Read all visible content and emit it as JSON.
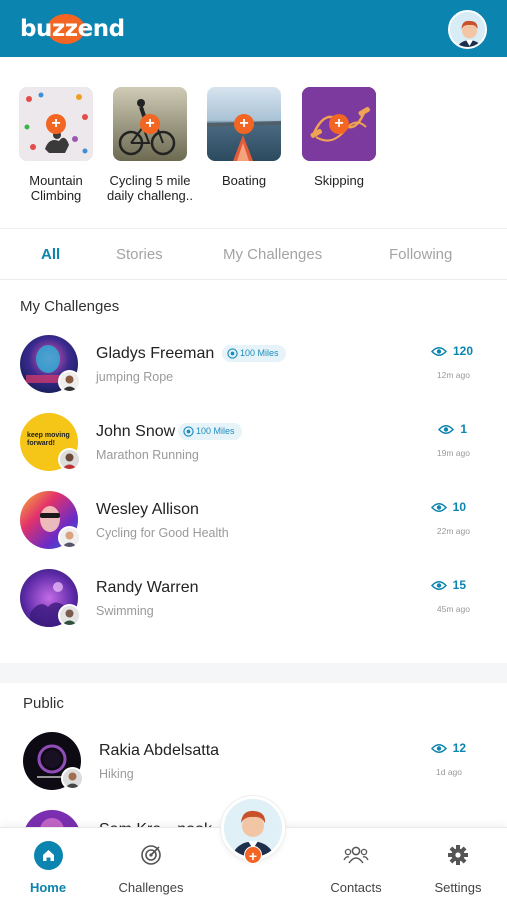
{
  "header": {
    "logo_text": "buzzend"
  },
  "categories": [
    {
      "label": "Mountain Climbing",
      "plus": "+"
    },
    {
      "label": "Cycling 5 mile daily challeng..",
      "plus": "+"
    },
    {
      "label": "Boating",
      "plus": "+"
    },
    {
      "label": "Skipping",
      "plus": "+"
    }
  ],
  "tabs": [
    {
      "label": "All",
      "active": true
    },
    {
      "label": "Stories",
      "active": false
    },
    {
      "label": "My Challenges",
      "active": false
    },
    {
      "label": "Following",
      "active": false
    }
  ],
  "my_challenges": {
    "title": "My Challenges",
    "items": [
      {
        "name": "Gladys Freeman",
        "badge": "100 Miles",
        "desc": "jumping Rope",
        "views": "120",
        "time": "12m ago"
      },
      {
        "name": "John Snow",
        "badge": "100 Miles",
        "desc": "Marathon Running",
        "views": "1",
        "time": "19m ago",
        "cover_text": "keep moving forward!"
      },
      {
        "name": "Wesley Allison",
        "badge": "",
        "desc": "Cycling for Good Health",
        "views": "10",
        "time": "22m ago"
      },
      {
        "name": "Randy Warren",
        "badge": "",
        "desc": "Swimming",
        "views": "15",
        "time": "45m ago"
      }
    ]
  },
  "public": {
    "title": "Public",
    "items": [
      {
        "name": "Rakia Abdelsatta",
        "desc": "Hiking",
        "views": "12",
        "time": "1d ago"
      },
      {
        "name": "Sam Kra…nook",
        "desc": "",
        "views": "",
        "time": ""
      }
    ]
  },
  "bottom_nav": [
    {
      "label": "Home",
      "icon": "home-icon",
      "active": true
    },
    {
      "label": "Challenges",
      "icon": "target-icon",
      "active": false
    },
    {
      "label": "Contacts",
      "icon": "contacts-icon",
      "active": false
    },
    {
      "label": "Settings",
      "icon": "gear-icon",
      "active": false
    }
  ],
  "fab": {
    "plus": "+"
  },
  "colors": {
    "brand_blue": "#0c84b0",
    "accent_orange": "#f26522"
  }
}
